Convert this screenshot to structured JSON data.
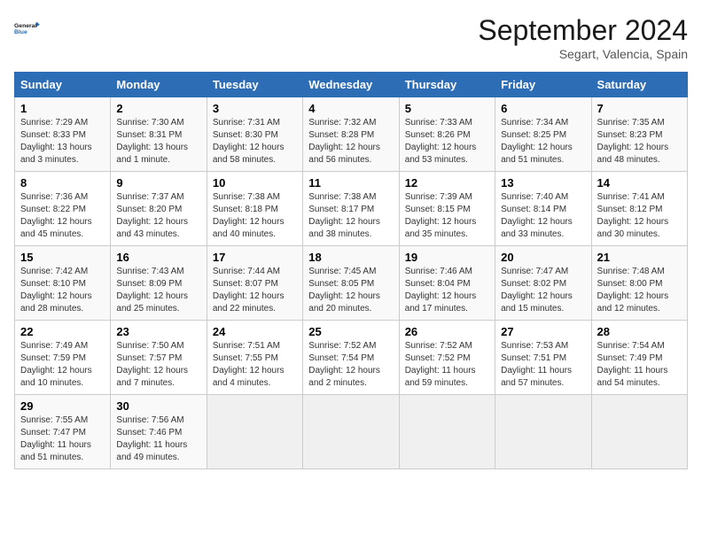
{
  "logo": {
    "text_general": "General",
    "text_blue": "Blue"
  },
  "title": "September 2024",
  "subtitle": "Segart, Valencia, Spain",
  "days_of_week": [
    "Sunday",
    "Monday",
    "Tuesday",
    "Wednesday",
    "Thursday",
    "Friday",
    "Saturday"
  ],
  "weeks": [
    [
      {
        "day": "1",
        "info": "Sunrise: 7:29 AM\nSunset: 8:33 PM\nDaylight: 13 hours\nand 3 minutes."
      },
      {
        "day": "2",
        "info": "Sunrise: 7:30 AM\nSunset: 8:31 PM\nDaylight: 13 hours\nand 1 minute."
      },
      {
        "day": "3",
        "info": "Sunrise: 7:31 AM\nSunset: 8:30 PM\nDaylight: 12 hours\nand 58 minutes."
      },
      {
        "day": "4",
        "info": "Sunrise: 7:32 AM\nSunset: 8:28 PM\nDaylight: 12 hours\nand 56 minutes."
      },
      {
        "day": "5",
        "info": "Sunrise: 7:33 AM\nSunset: 8:26 PM\nDaylight: 12 hours\nand 53 minutes."
      },
      {
        "day": "6",
        "info": "Sunrise: 7:34 AM\nSunset: 8:25 PM\nDaylight: 12 hours\nand 51 minutes."
      },
      {
        "day": "7",
        "info": "Sunrise: 7:35 AM\nSunset: 8:23 PM\nDaylight: 12 hours\nand 48 minutes."
      }
    ],
    [
      {
        "day": "8",
        "info": "Sunrise: 7:36 AM\nSunset: 8:22 PM\nDaylight: 12 hours\nand 45 minutes."
      },
      {
        "day": "9",
        "info": "Sunrise: 7:37 AM\nSunset: 8:20 PM\nDaylight: 12 hours\nand 43 minutes."
      },
      {
        "day": "10",
        "info": "Sunrise: 7:38 AM\nSunset: 8:18 PM\nDaylight: 12 hours\nand 40 minutes."
      },
      {
        "day": "11",
        "info": "Sunrise: 7:38 AM\nSunset: 8:17 PM\nDaylight: 12 hours\nand 38 minutes."
      },
      {
        "day": "12",
        "info": "Sunrise: 7:39 AM\nSunset: 8:15 PM\nDaylight: 12 hours\nand 35 minutes."
      },
      {
        "day": "13",
        "info": "Sunrise: 7:40 AM\nSunset: 8:14 PM\nDaylight: 12 hours\nand 33 minutes."
      },
      {
        "day": "14",
        "info": "Sunrise: 7:41 AM\nSunset: 8:12 PM\nDaylight: 12 hours\nand 30 minutes."
      }
    ],
    [
      {
        "day": "15",
        "info": "Sunrise: 7:42 AM\nSunset: 8:10 PM\nDaylight: 12 hours\nand 28 minutes."
      },
      {
        "day": "16",
        "info": "Sunrise: 7:43 AM\nSunset: 8:09 PM\nDaylight: 12 hours\nand 25 minutes."
      },
      {
        "day": "17",
        "info": "Sunrise: 7:44 AM\nSunset: 8:07 PM\nDaylight: 12 hours\nand 22 minutes."
      },
      {
        "day": "18",
        "info": "Sunrise: 7:45 AM\nSunset: 8:05 PM\nDaylight: 12 hours\nand 20 minutes."
      },
      {
        "day": "19",
        "info": "Sunrise: 7:46 AM\nSunset: 8:04 PM\nDaylight: 12 hours\nand 17 minutes."
      },
      {
        "day": "20",
        "info": "Sunrise: 7:47 AM\nSunset: 8:02 PM\nDaylight: 12 hours\nand 15 minutes."
      },
      {
        "day": "21",
        "info": "Sunrise: 7:48 AM\nSunset: 8:00 PM\nDaylight: 12 hours\nand 12 minutes."
      }
    ],
    [
      {
        "day": "22",
        "info": "Sunrise: 7:49 AM\nSunset: 7:59 PM\nDaylight: 12 hours\nand 10 minutes."
      },
      {
        "day": "23",
        "info": "Sunrise: 7:50 AM\nSunset: 7:57 PM\nDaylight: 12 hours\nand 7 minutes."
      },
      {
        "day": "24",
        "info": "Sunrise: 7:51 AM\nSunset: 7:55 PM\nDaylight: 12 hours\nand 4 minutes."
      },
      {
        "day": "25",
        "info": "Sunrise: 7:52 AM\nSunset: 7:54 PM\nDaylight: 12 hours\nand 2 minutes."
      },
      {
        "day": "26",
        "info": "Sunrise: 7:52 AM\nSunset: 7:52 PM\nDaylight: 11 hours\nand 59 minutes."
      },
      {
        "day": "27",
        "info": "Sunrise: 7:53 AM\nSunset: 7:51 PM\nDaylight: 11 hours\nand 57 minutes."
      },
      {
        "day": "28",
        "info": "Sunrise: 7:54 AM\nSunset: 7:49 PM\nDaylight: 11 hours\nand 54 minutes."
      }
    ],
    [
      {
        "day": "29",
        "info": "Sunrise: 7:55 AM\nSunset: 7:47 PM\nDaylight: 11 hours\nand 51 minutes."
      },
      {
        "day": "30",
        "info": "Sunrise: 7:56 AM\nSunset: 7:46 PM\nDaylight: 11 hours\nand 49 minutes."
      },
      {
        "day": "",
        "info": ""
      },
      {
        "day": "",
        "info": ""
      },
      {
        "day": "",
        "info": ""
      },
      {
        "day": "",
        "info": ""
      },
      {
        "day": "",
        "info": ""
      }
    ]
  ]
}
